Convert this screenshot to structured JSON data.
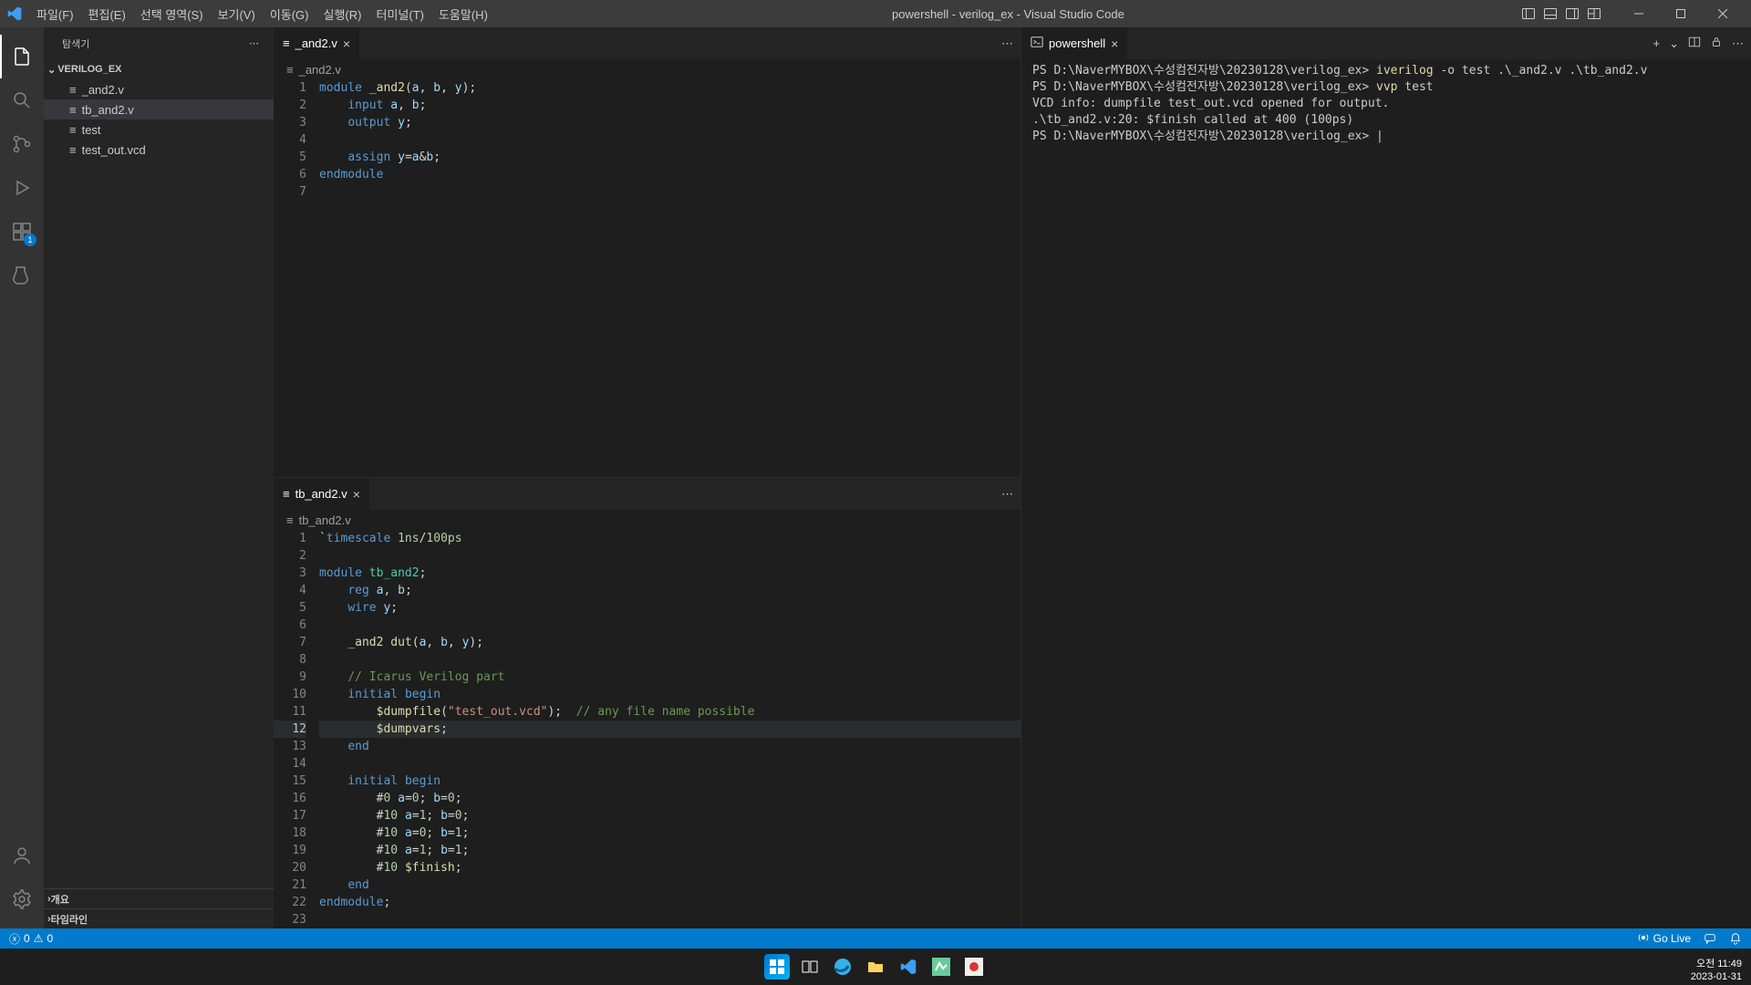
{
  "title": "powershell - verilog_ex - Visual Studio Code",
  "menu": [
    "파일(F)",
    "편집(E)",
    "선택 영역(S)",
    "보기(V)",
    "이동(G)",
    "실행(R)",
    "터미널(T)",
    "도움말(H)"
  ],
  "sidebar": {
    "header": "탐색기",
    "project": "VERILOG_EX",
    "files": [
      {
        "name": "_and2.v"
      },
      {
        "name": "tb_and2.v"
      },
      {
        "name": "test"
      },
      {
        "name": "test_out.vcd"
      }
    ],
    "outline": "개요",
    "timeline": "타임라인"
  },
  "activity": {
    "ext_badge": "1"
  },
  "tabs": {
    "left_top": "_and2.v",
    "left_bottom": "tb_and2.v",
    "right": "powershell"
  },
  "breadcrumb": {
    "top": "_and2.v",
    "bottom": "tb_and2.v"
  },
  "editor1": {
    "lines": [
      {
        "n": 1,
        "html": "<span class='kw'>module</span> <span class='fn'>_and2</span>(<span class='id'>a</span>, <span class='id'>b</span>, <span class='id'>y</span>);"
      },
      {
        "n": 2,
        "html": "    <span class='kw'>input</span> <span class='id'>a</span>, <span class='id'>b</span>;"
      },
      {
        "n": 3,
        "html": "    <span class='kw'>output</span> <span class='id'>y</span>;"
      },
      {
        "n": 4,
        "html": ""
      },
      {
        "n": 5,
        "html": "    <span class='kw'>assign</span> <span class='id'>y</span>=<span class='id'>a</span>&amp;<span class='id'>b</span>;"
      },
      {
        "n": 6,
        "html": "<span class='kw'>endmodule</span>"
      },
      {
        "n": 7,
        "html": ""
      }
    ]
  },
  "editor2": {
    "lines": [
      {
        "n": 1,
        "html": "<span class='op'>`</span><span class='kw'>timescale</span> <span class='num'>1ns</span>/<span class='num'>100ps</span>"
      },
      {
        "n": 2,
        "html": ""
      },
      {
        "n": 3,
        "html": "<span class='kw'>module</span> <span class='typ'>tb_and2</span>;"
      },
      {
        "n": 4,
        "html": "    <span class='kw'>reg</span> <span class='id'>a</span>, <span class='id'>b</span>;"
      },
      {
        "n": 5,
        "html": "    <span class='kw'>wire</span> <span class='id'>y</span>;"
      },
      {
        "n": 6,
        "html": ""
      },
      {
        "n": 7,
        "html": "    <span class='fn'>_and2</span> <span class='fn'>dut</span>(<span class='id'>a</span>, <span class='id'>b</span>, <span class='id'>y</span>);"
      },
      {
        "n": 8,
        "html": ""
      },
      {
        "n": 9,
        "html": "    <span class='cmt'>// Icarus Verilog part</span>"
      },
      {
        "n": 10,
        "html": "    <span class='kw'>initial</span> <span class='kw'>begin</span>"
      },
      {
        "n": 11,
        "html": "        <span class='fn'>$dumpfile</span>(<span class='str'>\"test_out.vcd\"</span>);  <span class='cmt'>// any file name possible</span>"
      },
      {
        "n": 12,
        "html": "        <span class='fn'>$dumpvars</span>;",
        "hl": true
      },
      {
        "n": 13,
        "html": "    <span class='kw'>end</span>"
      },
      {
        "n": 14,
        "html": ""
      },
      {
        "n": 15,
        "html": "    <span class='kw'>initial</span> <span class='kw'>begin</span>"
      },
      {
        "n": 16,
        "html": "        #<span class='num'>0</span> <span class='id'>a</span>=<span class='num'>0</span>; <span class='id'>b</span>=<span class='num'>0</span>;"
      },
      {
        "n": 17,
        "html": "        #<span class='num'>10</span> <span class='id'>a</span>=<span class='num'>1</span>; <span class='id'>b</span>=<span class='num'>0</span>;"
      },
      {
        "n": 18,
        "html": "        #<span class='num'>10</span> <span class='id'>a</span>=<span class='num'>0</span>; <span class='id'>b</span>=<span class='num'>1</span>;"
      },
      {
        "n": 19,
        "html": "        #<span class='num'>10</span> <span class='id'>a</span>=<span class='num'>1</span>; <span class='id'>b</span>=<span class='num'>1</span>;"
      },
      {
        "n": 20,
        "html": "        #<span class='num'>10</span> <span class='fn'>$finish</span>;"
      },
      {
        "n": 21,
        "html": "    <span class='kw'>end</span>"
      },
      {
        "n": 22,
        "html": "<span class='kw'>endmodule</span>;"
      },
      {
        "n": 23,
        "html": ""
      }
    ]
  },
  "terminal": {
    "lines": [
      {
        "html": "PS D:\\NaverMYBOX\\수성컴전자방\\20230128\\verilog_ex&gt; <span class='term-yellow'>iverilog</span> -o test .\\_and2.v .\\tb_and2.v"
      },
      {
        "html": "PS D:\\NaverMYBOX\\수성컴전자방\\20230128\\verilog_ex&gt; <span class='term-yellow'>vvp</span> test"
      },
      {
        "html": "VCD info: dumpfile test_out.vcd opened for output."
      },
      {
        "html": ".\\tb_and2.v:20: $finish called at 400 (100ps)"
      },
      {
        "html": "PS D:\\NaverMYBOX\\수성컴전자방\\20230128\\verilog_ex&gt; |"
      }
    ]
  },
  "status": {
    "errors": "0",
    "warnings": "0",
    "golive": "Go Live"
  },
  "taskbar": {
    "time": "오전 11:49",
    "date": "2023-01-31"
  }
}
